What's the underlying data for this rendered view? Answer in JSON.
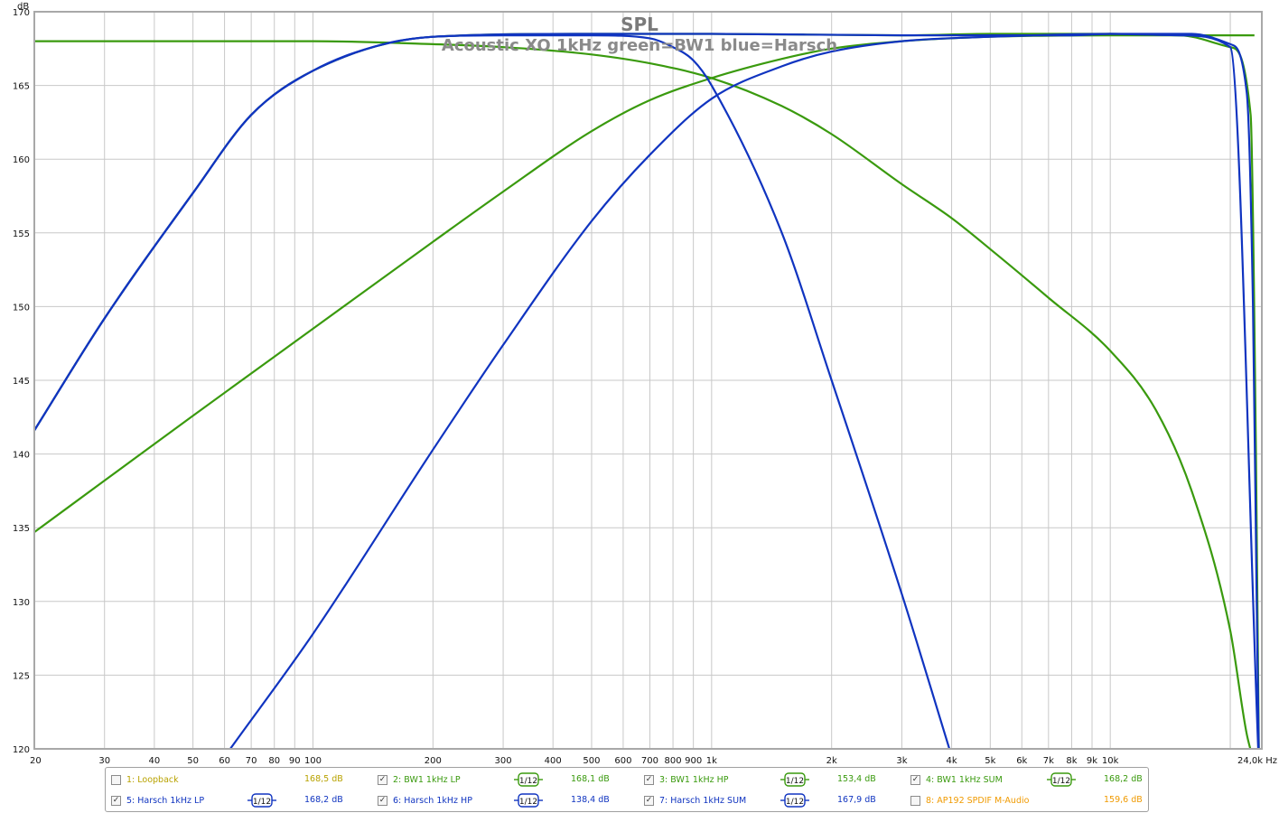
{
  "chart_data": {
    "type": "line",
    "title": "SPL",
    "subtitle": "Acoustic XO 1kHz green=BW1 blue=Harsch",
    "ylabel": "dB",
    "xlabel_unit": "Hz",
    "x_scale": "log",
    "xlim": [
      20,
      24000
    ],
    "ylim": [
      120,
      170
    ],
    "y_ticks": [
      "170",
      "165",
      "160",
      "155",
      "150",
      "145",
      "140",
      "135",
      "130",
      "125",
      "120"
    ],
    "x_ticks": [
      {
        "v": 20,
        "label": "20"
      },
      {
        "v": 30,
        "label": "30"
      },
      {
        "v": 40,
        "label": "40"
      },
      {
        "v": 50,
        "label": "50"
      },
      {
        "v": 60,
        "label": "60"
      },
      {
        "v": 70,
        "label": "70"
      },
      {
        "v": 80,
        "label": "80"
      },
      {
        "v": 90,
        "label": "90"
      },
      {
        "v": 100,
        "label": "100"
      },
      {
        "v": 200,
        "label": "200"
      },
      {
        "v": 300,
        "label": "300"
      },
      {
        "v": 400,
        "label": "400"
      },
      {
        "v": 500,
        "label": "500"
      },
      {
        "v": 600,
        "label": "600"
      },
      {
        "v": 700,
        "label": "700"
      },
      {
        "v": 800,
        "label": "800"
      },
      {
        "v": 900,
        "label": "900"
      },
      {
        "v": 1000,
        "label": "1k"
      },
      {
        "v": 2000,
        "label": "2k"
      },
      {
        "v": 3000,
        "label": "3k"
      },
      {
        "v": 4000,
        "label": "4k"
      },
      {
        "v": 5000,
        "label": "5k"
      },
      {
        "v": 6000,
        "label": "6k"
      },
      {
        "v": 7000,
        "label": "7k"
      },
      {
        "v": 8000,
        "label": "8k"
      },
      {
        "v": 9000,
        "label": "9k"
      },
      {
        "v": 10000,
        "label": "10k"
      },
      {
        "v": 24000,
        "label": "24,0k Hz"
      }
    ],
    "grid": true,
    "series": [
      {
        "name": "2: BW1 1kHz LP",
        "color": "#3a9a0e",
        "x": [
          20,
          30,
          50,
          100,
          200,
          300,
          500,
          700,
          1000,
          1500,
          2000,
          3000,
          4000,
          5000,
          7000,
          10000,
          13000,
          16000,
          20000,
          22000,
          23000
        ],
        "y": [
          168.0,
          168.0,
          168.0,
          168.0,
          167.8,
          167.6,
          167.1,
          166.5,
          165.5,
          163.6,
          161.7,
          158.3,
          156.0,
          153.9,
          150.6,
          147.0,
          143.0,
          137.5,
          128.0,
          121.0,
          119.0
        ]
      },
      {
        "name": "3: BW1 1kHz HP",
        "color": "#3a9a0e",
        "x": [
          20,
          30,
          50,
          100,
          200,
          300,
          500,
          700,
          1000,
          1500,
          2000,
          3000,
          5000,
          10000,
          20000,
          23000
        ],
        "y": [
          134.7,
          138.2,
          142.6,
          148.5,
          154.4,
          157.8,
          161.9,
          164.0,
          165.5,
          166.8,
          167.5,
          168.0,
          168.3,
          168.4,
          168.4,
          168.4
        ]
      },
      {
        "name": "4: BW1 1kHz SUM",
        "color": "#3a9a0e",
        "x": [
          20,
          30,
          50,
          70,
          100,
          200,
          500,
          1000,
          3000,
          5000,
          10000,
          15000,
          20000,
          22500,
          23200,
          23600
        ],
        "y": [
          141.6,
          149.2,
          157.7,
          163.0,
          166.0,
          168.3,
          168.5,
          168.5,
          168.4,
          168.5,
          168.5,
          168.4,
          167.6,
          163.0,
          140.0,
          119.0
        ]
      },
      {
        "name": "5: Harsch 1kHz LP",
        "color": "#1034c0",
        "x": [
          20,
          30,
          50,
          70,
          100,
          150,
          200,
          300,
          500,
          700,
          800,
          900,
          1000,
          1500,
          2000,
          3000,
          4000
        ],
        "y": [
          141.6,
          149.2,
          157.7,
          163.0,
          166.0,
          167.8,
          168.3,
          168.4,
          168.4,
          168.2,
          167.6,
          166.7,
          165.0,
          155.0,
          145.0,
          130.5,
          119.5
        ]
      },
      {
        "name": "6: Harsch 1kHz HP",
        "color": "#1034c0",
        "x": [
          62,
          100,
          200,
          300,
          500,
          700,
          1000,
          1500,
          2000,
          3000,
          5000,
          10000,
          15000,
          20000,
          23500
        ],
        "y": [
          120.0,
          127.8,
          140.3,
          147.4,
          155.8,
          160.3,
          164.1,
          166.3,
          167.3,
          168.0,
          168.3,
          168.5,
          168.4,
          167.6,
          120.0
        ]
      },
      {
        "name": "7: Harsch 1kHz SUM",
        "color": "#1034c0",
        "x": [
          20,
          30,
          50,
          70,
          100,
          200,
          500,
          1000,
          3000,
          5000,
          8000,
          10000,
          13000,
          16000,
          20000,
          22000,
          22800,
          23300,
          23600
        ],
        "y": [
          141.6,
          149.2,
          157.7,
          163.0,
          166.0,
          168.3,
          168.5,
          168.5,
          168.4,
          168.4,
          168.4,
          168.5,
          168.5,
          168.5,
          167.8,
          164.5,
          150.0,
          130.0,
          119.0
        ]
      }
    ],
    "legend": [
      {
        "name": "1: Loopback",
        "checked": false,
        "value": "168,5 dB",
        "color": "#b8a200",
        "smoothing": ""
      },
      {
        "name": "2: BW1 1kHz LP",
        "checked": true,
        "value": "168,1 dB",
        "color": "#3a9a0e",
        "smoothing": "1/12"
      },
      {
        "name": "3: BW1 1kHz HP",
        "checked": true,
        "value": "153,4 dB",
        "color": "#3a9a0e",
        "smoothing": "1/12"
      },
      {
        "name": "4: BW1 1kHz SUM",
        "checked": true,
        "value": "168,2 dB",
        "color": "#3a9a0e",
        "smoothing": "1/12"
      },
      {
        "name": "5: Harsch 1kHz LP",
        "checked": true,
        "value": "168,2 dB",
        "color": "#1034c0",
        "smoothing": "1/12"
      },
      {
        "name": "6: Harsch 1kHz HP",
        "checked": true,
        "value": "138,4 dB",
        "color": "#1034c0",
        "smoothing": "1/12"
      },
      {
        "name": "7: Harsch 1kHz SUM",
        "checked": true,
        "value": "167,9 dB",
        "color": "#1034c0",
        "smoothing": "1/12"
      },
      {
        "name": "8: AP192 SPDIF M-Audio",
        "checked": false,
        "value": "159,6 dB",
        "color": "#f09a00",
        "smoothing": ""
      }
    ]
  }
}
